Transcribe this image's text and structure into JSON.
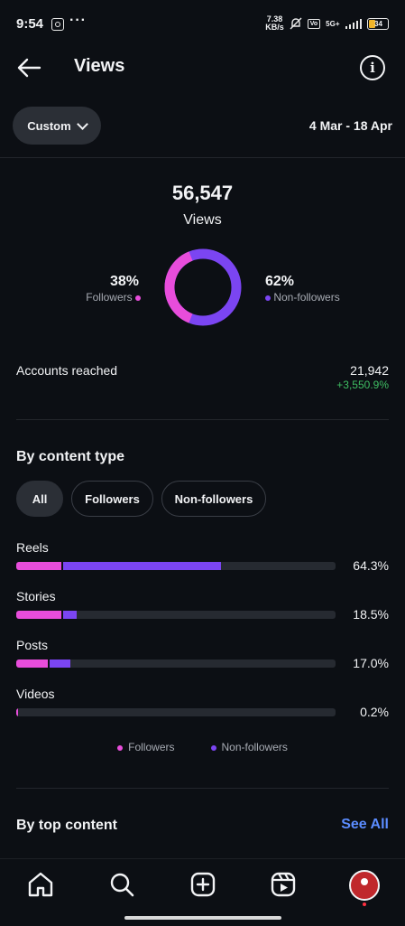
{
  "status": {
    "time": "9:54",
    "speed_value": "7.38",
    "speed_unit": "KB/s",
    "vo_label": "Vo",
    "network": "5G+",
    "battery": "34"
  },
  "header": {
    "title": "Views"
  },
  "range": {
    "custom_label": "Custom",
    "date_range": "4 Mar - 18 Apr"
  },
  "summary": {
    "total": "56,547",
    "total_label": "Views",
    "followers_pct": "38%",
    "followers_label": "Followers",
    "nonfollowers_pct": "62%",
    "nonfollowers_label": "Non-followers",
    "followers_fraction": 0.38
  },
  "accounts": {
    "label": "Accounts reached",
    "value": "21,942",
    "change": "+3,550.9%"
  },
  "content_type": {
    "title": "By content type",
    "tabs": [
      "All",
      "Followers",
      "Non-followers"
    ],
    "rows": [
      {
        "label": "Reels",
        "pct": "64.3%",
        "followers_share": 0.14,
        "nonfollowers_share": 0.5
      },
      {
        "label": "Stories",
        "pct": "18.5%",
        "followers_share": 0.14,
        "nonfollowers_share": 0.05
      },
      {
        "label": "Posts",
        "pct": "17.0%",
        "followers_share": 0.1,
        "nonfollowers_share": 0.07
      },
      {
        "label": "Videos",
        "pct": "0.2%",
        "followers_share": 0.004,
        "nonfollowers_share": 0.0
      }
    ],
    "legend": [
      "Followers",
      "Non-followers"
    ]
  },
  "top_content": {
    "title": "By top content",
    "see_all": "See All"
  },
  "colors": {
    "followers": "#e84ddb",
    "nonfollowers": "#7b45f2",
    "positive": "#3fbf63",
    "link": "#5b8cff"
  },
  "icons": [
    "home-icon",
    "search-icon",
    "create-icon",
    "reels-icon",
    "profile-avatar"
  ]
}
